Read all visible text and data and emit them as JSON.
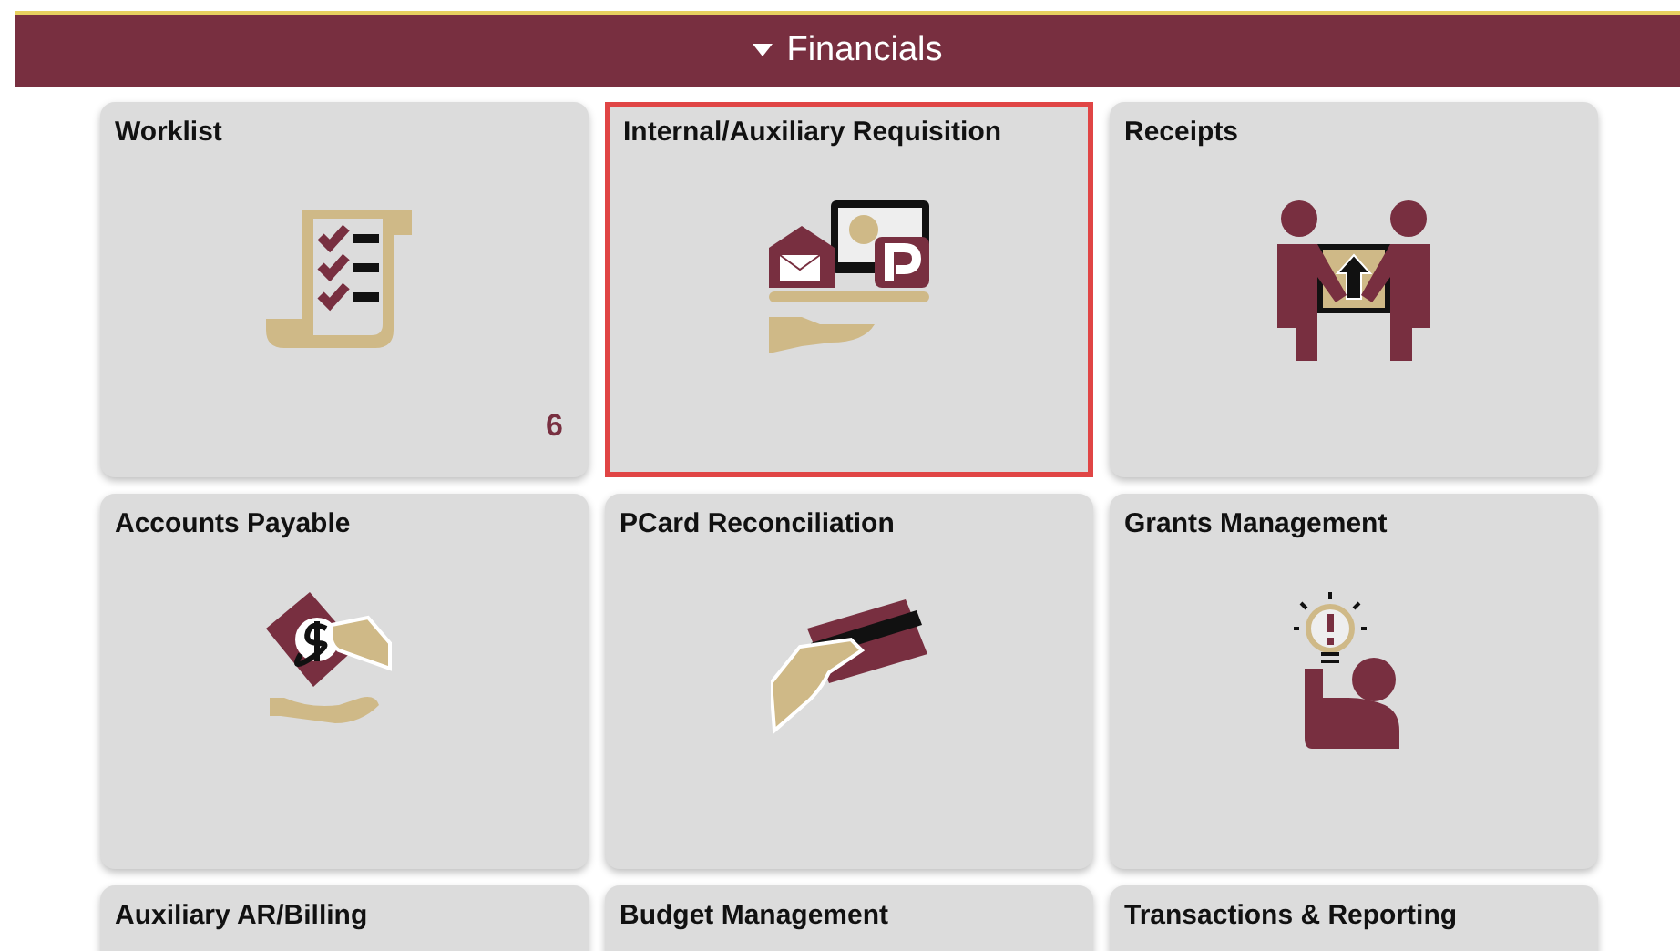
{
  "section": {
    "title": "Financials",
    "expanded": true
  },
  "tiles": [
    {
      "title": "Worklist",
      "selected": false,
      "badge": "6"
    },
    {
      "title": "Internal/Auxiliary Requisition",
      "selected": true
    },
    {
      "title": "Receipts",
      "selected": false
    },
    {
      "title": "Accounts Payable",
      "selected": false
    },
    {
      "title": "PCard Reconciliation",
      "selected": false
    },
    {
      "title": "Grants Management",
      "selected": false
    },
    {
      "title": "Auxiliary AR/Billing",
      "selected": false
    },
    {
      "title": "Budget Management",
      "selected": false
    },
    {
      "title": "Transactions & Reporting",
      "selected": false
    }
  ]
}
